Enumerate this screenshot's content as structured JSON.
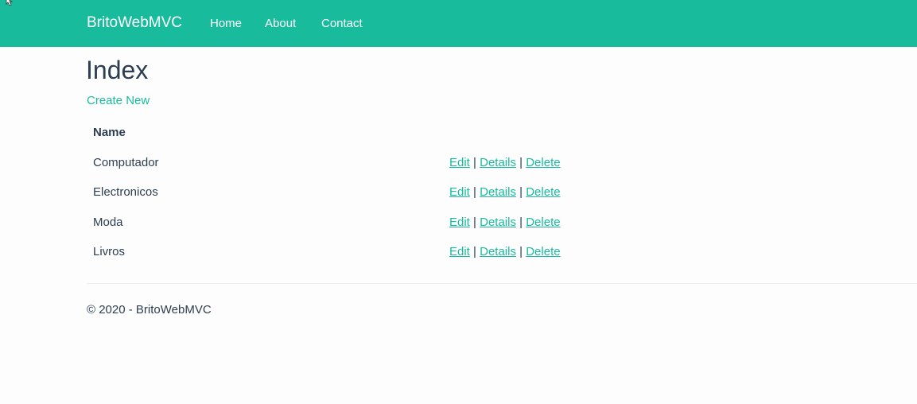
{
  "navbar": {
    "brand": "BritoWebMVC",
    "links": [
      "Home",
      "About",
      "Contact"
    ]
  },
  "page": {
    "title": "Index",
    "create_label": "Create New"
  },
  "table": {
    "header_name": "Name",
    "rows": [
      {
        "name": "Computador"
      },
      {
        "name": "Electronicos"
      },
      {
        "name": "Moda"
      },
      {
        "name": "Livros"
      }
    ],
    "actions": {
      "edit": "Edit",
      "details": "Details",
      "delete": "Delete",
      "separator": "|"
    }
  },
  "footer": {
    "text": "© 2020 - BritoWebMVC"
  },
  "colors": {
    "navbar_bg": "#18bc9c",
    "text": "#2c3e50",
    "link": "#18bc9c",
    "page_bg": "#fdfdfd"
  }
}
